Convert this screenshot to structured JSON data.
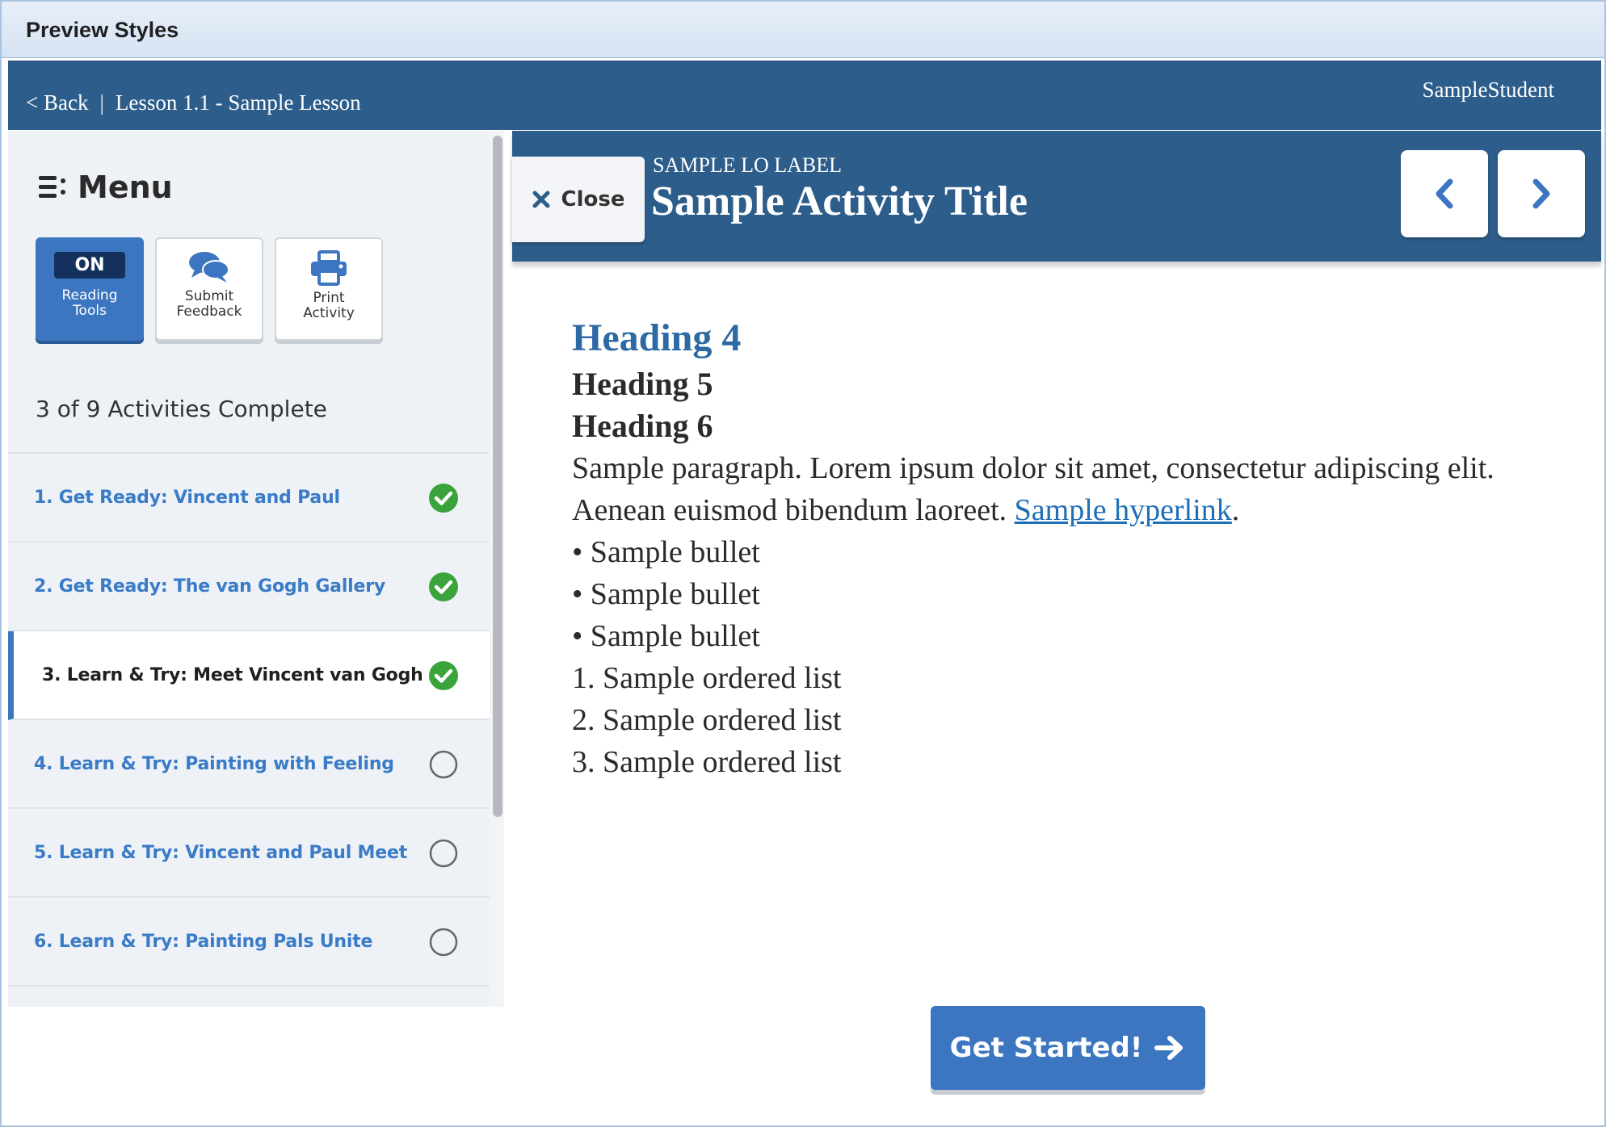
{
  "window": {
    "title": "Preview Styles"
  },
  "topbar": {
    "back_label": "< Back",
    "separator": "|",
    "lesson": "Lesson 1.1 - Sample Lesson",
    "user": "SampleStudent"
  },
  "sidebar": {
    "menu_label": "Menu",
    "tools": [
      {
        "label": "Reading\nTools",
        "state": "ON"
      },
      {
        "label": "Submit\nFeedback"
      },
      {
        "label": "Print\nActivity"
      }
    ],
    "progress": "3 of 9 Activities Complete",
    "activities": [
      {
        "label": "1.  Get Ready: Vincent and Paul",
        "status": "complete"
      },
      {
        "label": "2.  Get Ready: The van Gogh Gallery",
        "status": "complete"
      },
      {
        "label": "3.  Learn & Try: Meet Vincent van Gogh",
        "status": "complete"
      },
      {
        "label": "4.  Learn & Try: Painting with Feeling",
        "status": "incomplete"
      },
      {
        "label": "5.  Learn & Try: Vincent and Paul Meet",
        "status": "incomplete"
      },
      {
        "label": "6.  Learn & Try: Painting Pals Unite",
        "status": "incomplete"
      }
    ]
  },
  "activity": {
    "close_label": "Close",
    "lo_label": "SAMPLE LO LABEL",
    "title": "Sample Activity Title"
  },
  "content": {
    "h4": "Heading 4",
    "h5": "Heading 5",
    "h6": "Heading 6",
    "paragraph": "Sample paragraph. Lorem ipsum dolor sit amet, consectetur adipiscing elit. Aenean euismod bibendum laoreet. ",
    "link": "Sample hyperlink",
    "paragraph_end": ".",
    "bullets": [
      "• Sample bullet",
      "• Sample bullet",
      "• Sample bullet"
    ],
    "ordered": [
      "1. Sample ordered list",
      "2. Sample ordered list",
      "3. Sample ordered list"
    ]
  },
  "start_button": {
    "label": "Get Started!"
  },
  "colors": {
    "brand_blue": "#2d5d8a",
    "accent_blue": "#3d76c0",
    "complete_green": "#3aa33c"
  }
}
